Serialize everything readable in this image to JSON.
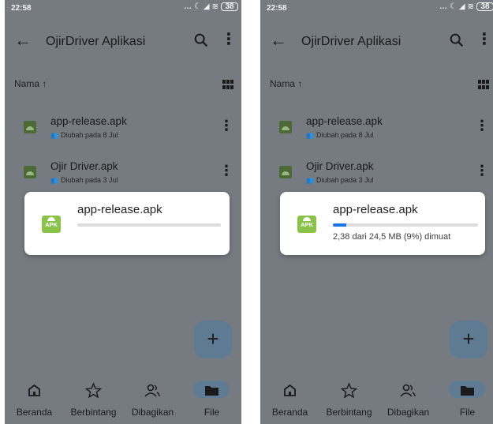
{
  "screens": [
    {
      "status_time": "22:58",
      "battery": "38",
      "appbar": {
        "title": "OjirDriver Aplikasi"
      },
      "sort_label": "Nama ↑",
      "files": [
        {
          "name": "app-release.apk",
          "meta": "Diubah pada 8 Jul"
        },
        {
          "name": "Ojir Driver.apk",
          "meta": "Diubah pada 3 Jul"
        }
      ],
      "dialog": {
        "file_name": "app-release.apk",
        "icon_label": "APK",
        "progress_fraction": 0,
        "progress_text": ""
      },
      "fab_label": "+",
      "nav": [
        {
          "label": "Beranda",
          "icon": "home-icon"
        },
        {
          "label": "Berbintang",
          "icon": "star-icon"
        },
        {
          "label": "Dibagikan",
          "icon": "shared-icon"
        },
        {
          "label": "File",
          "icon": "folder-icon"
        }
      ]
    },
    {
      "status_time": "22:58",
      "battery": "38",
      "appbar": {
        "title": "OjirDriver Aplikasi"
      },
      "sort_label": "Nama ↑",
      "files": [
        {
          "name": "app-release.apk",
          "meta": "Diubah pada 8 Jul"
        },
        {
          "name": "Ojir Driver.apk",
          "meta": "Diubah pada 3 Jul"
        }
      ],
      "dialog": {
        "file_name": "app-release.apk",
        "icon_label": "APK",
        "progress_fraction": 0.09,
        "progress_text": "2,38 dari 24,5 MB (9%) dimuat"
      },
      "fab_label": "+",
      "nav": [
        {
          "label": "Beranda",
          "icon": "home-icon"
        },
        {
          "label": "Berbintang",
          "icon": "star-icon"
        },
        {
          "label": "Dibagikan",
          "icon": "shared-icon"
        },
        {
          "label": "File",
          "icon": "folder-icon"
        }
      ]
    }
  ]
}
